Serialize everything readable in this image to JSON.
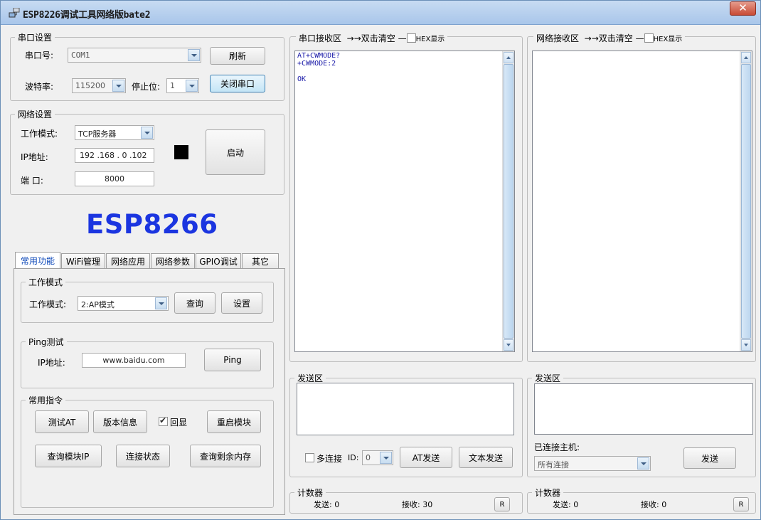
{
  "window": {
    "title": "ESP8226调试工具网络版bate2",
    "close_glyph": "✕"
  },
  "serial_settings": {
    "group_label": "串口设置",
    "port_label": "串口号:",
    "port_value": "COM1",
    "refresh_button": "刷新",
    "baud_label": "波特率:",
    "baud_value": "115200",
    "stopbits_label": "停止位:",
    "stopbits_value": "1",
    "close_port_button": "关闭串口"
  },
  "network_settings": {
    "group_label": "网络设置",
    "mode_label": "工作模式:",
    "mode_value": "TCP服务器",
    "ip_label": "IP地址:",
    "ip_value": "192 .168 . 0  .102",
    "port_label": "端  口:",
    "port_value": "8000",
    "start_button": "启动"
  },
  "brand": "ESP8266",
  "tabs": [
    {
      "label": "常用功能",
      "selected": true
    },
    {
      "label": "WiFi管理"
    },
    {
      "label": "网络应用"
    },
    {
      "label": "网络参数"
    },
    {
      "label": "GPIO调试"
    },
    {
      "label": "其它"
    }
  ],
  "work_mode": {
    "group_label": "工作模式",
    "mode_label": "工作模式:",
    "mode_value": "2:AP模式",
    "query_button": "查询",
    "set_button": "设置"
  },
  "ping": {
    "group_label": "Ping测试",
    "ip_label": "IP地址:",
    "ip_value": "www.baidu.com",
    "ping_button": "Ping"
  },
  "common_commands": {
    "group_label": "常用指令",
    "test_at": "测试AT",
    "version_info": "版本信息",
    "echo_label": "回显",
    "echo_checked": true,
    "restart": "重启模块",
    "query_ip": "查询模块IP",
    "conn_status": "连接状态",
    "query_mem": "查询剩余内存"
  },
  "serial_receive": {
    "label": "串口接收区",
    "dbl_click_label": "→→双击清空",
    "hex_label": "HEX显示",
    "hex_checked": false,
    "content": "AT+CWMODE?\n+CWMODE:2\n\nOK"
  },
  "network_receive": {
    "label": "网络接收区",
    "dbl_click_label": "→→双击清空",
    "hex_label": "HEX显示",
    "hex_checked": false,
    "content": ""
  },
  "serial_send": {
    "group_label": "发送区",
    "multi_conn_label": "多连接",
    "multi_conn_checked": false,
    "id_label": "ID:",
    "id_value": "0",
    "at_send_button": "AT发送",
    "text_send_button": "文本发送"
  },
  "network_send": {
    "group_label": "发送区",
    "connected_host_label": "已连接主机:",
    "host_value": "所有连接",
    "send_button": "发送"
  },
  "serial_counter": {
    "group_label": "计数器",
    "sent_label": "发送:",
    "sent_value": "0",
    "recv_label": "接收:",
    "recv_value": "30",
    "reset_button": "R"
  },
  "network_counter": {
    "group_label": "计数器",
    "sent_label": "发送:",
    "sent_value": "0",
    "recv_label": "接收:",
    "recv_value": "0",
    "reset_button": "R"
  },
  "colors": {
    "brand": "#1b35e0",
    "status_indicator": "#000000",
    "serial_text": "#1a1aa8"
  }
}
